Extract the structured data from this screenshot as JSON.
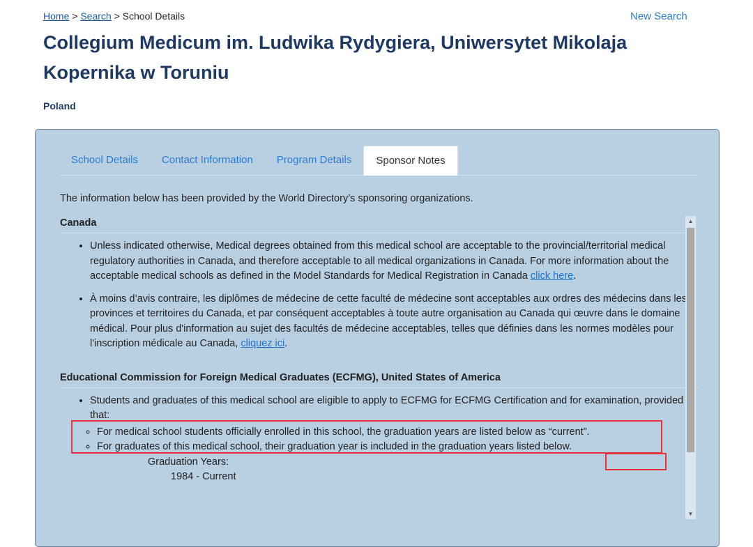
{
  "breadcrumb": {
    "home": "Home",
    "sep1": ">",
    "search": "Search",
    "sep2": ">",
    "current": "School Details"
  },
  "new_search": "New Search",
  "school": {
    "name": "Collegium Medicum im. Ludwika Rydygiera, Uniwersytet Mikolaja Kopernika w Toruniu",
    "country": "Poland"
  },
  "tabs": [
    "School Details",
    "Contact Information",
    "Program Details",
    "Sponsor Notes"
  ],
  "active_tab": "Sponsor Notes",
  "intro": "The information below has been provided by the World Directory’s sponsoring organizations.",
  "canada": {
    "heading": "Canada",
    "bullet1_text": "Unless indicated otherwise, Medical degrees obtained from this medical school are acceptable to the provincial/territorial medical regulatory authorities in Canada, and therefore acceptable to all medical organizations in Canada. For more information about the acceptable medical schools as defined in the Model Standards for Medical Registration in Canada ",
    "bullet1_link": "click here",
    "bullet1_end": ".",
    "bullet2_text": "À moins d’avis contraire, les diplômes de médecine de cette faculté de médecine sont acceptables aux ordres des médecins dans les provinces et territoires du Canada, et par conséquent acceptables à toute autre organisation au Canada qui œuvre dans le domaine médical. Pour plus d'information au sujet des facultés de médecine acceptables, telles que définies dans les normes modèles pour l'inscription médicale au Canada, ",
    "bullet2_link": "cliquez ici",
    "bullet2_end": "."
  },
  "ecfmg": {
    "heading": "Educational Commission for Foreign Medical Graduates (ECFMG), United States of America",
    "bullet": "Students and graduates of this medical school are eligible to apply to ECFMG for ECFMG Certification and for examination, provided that:",
    "sub1": "For medical school students officially enrolled in this school, the graduation years are listed below as “current”.",
    "sub2": "For graduates of this medical school, their graduation year is included in the graduation years listed below.",
    "grad_label": "Graduation Years:",
    "grad_value": "1984 - Current"
  },
  "colors": {
    "panel_bg": "#b9cfe2",
    "title": "#1e3a63",
    "link": "#2a7bd3",
    "highlight": "#e3343d"
  }
}
